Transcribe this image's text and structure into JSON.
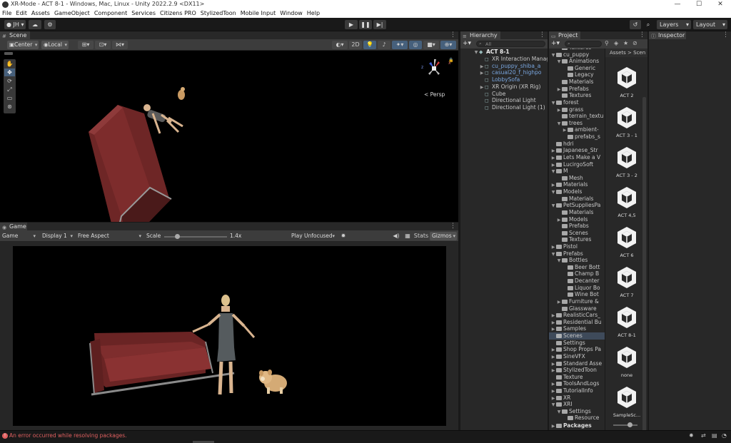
{
  "window": {
    "title": "XR-Mode - ACT 8-1 - Windows, Mac, Linux - Unity 2022.2.9 <DX11>",
    "minimize": "—",
    "maximize": "☐",
    "close": "✕"
  },
  "menu": [
    "File",
    "Edit",
    "Assets",
    "GameObject",
    "Component",
    "Services",
    "Citizens PRO",
    "StylizedToon",
    "Mobile Input",
    "Window",
    "Help"
  ],
  "toolbar": {
    "account": "JH",
    "layers": "Layers",
    "layout": "Layout",
    "search_icon": "search-icon"
  },
  "scene": {
    "tab": "Scene",
    "pivot": "Center",
    "space": "Local",
    "mode_2d": "2D",
    "gizmo_label": "< Persp",
    "axis_z": "z",
    "axis_x": "x"
  },
  "game": {
    "tab": "Game",
    "view": "Game",
    "display": "Display 1",
    "aspect": "Free Aspect",
    "scale_label": "Scale",
    "scale_value": "1.4x",
    "scale_fraction": 0.2,
    "play_mode": "Play Unfocused",
    "stats": "Stats",
    "gizmos": "Gizmos"
  },
  "hierarchy": {
    "tab": "Hierarchy",
    "search_placeholder": "All",
    "scene_name": "ACT 8-1",
    "items": [
      {
        "label": "XR Interaction Manag",
        "blue": false,
        "arrow": ""
      },
      {
        "label": "cu_puppy_shiba_a",
        "blue": true,
        "arrow": "▶"
      },
      {
        "label": "casual20_f_highpo",
        "blue": true,
        "arrow": "▶"
      },
      {
        "label": "LobbySofa",
        "blue": true,
        "arrow": ""
      },
      {
        "label": "XR Origin (XR Rig)",
        "blue": false,
        "arrow": "▶"
      },
      {
        "label": "Cube",
        "blue": false,
        "arrow": ""
      },
      {
        "label": "Directional Light",
        "blue": false,
        "arrow": ""
      },
      {
        "label": "Directional Light (1)",
        "blue": false,
        "arrow": ""
      }
    ]
  },
  "project": {
    "tab": "Project",
    "breadcrumb_assets": "Assets",
    "breadcrumb_sep": ">",
    "breadcrumb_current": "Scen",
    "tree": [
      {
        "label": "Textures",
        "depth": 2,
        "arrow": ""
      },
      {
        "label": "cu_puppy",
        "depth": 1,
        "arrow": "▼"
      },
      {
        "label": "Animations",
        "depth": 2,
        "arrow": "▼"
      },
      {
        "label": "Generic",
        "depth": 3,
        "arrow": ""
      },
      {
        "label": "Legacy",
        "depth": 3,
        "arrow": ""
      },
      {
        "label": "Materials",
        "depth": 2,
        "arrow": ""
      },
      {
        "label": "Prefabs",
        "depth": 2,
        "arrow": "▶"
      },
      {
        "label": "Textures",
        "depth": 2,
        "arrow": ""
      },
      {
        "label": "forest",
        "depth": 1,
        "arrow": "▼"
      },
      {
        "label": "grass",
        "depth": 2,
        "arrow": "▶"
      },
      {
        "label": "terrain_textu",
        "depth": 2,
        "arrow": ""
      },
      {
        "label": "trees",
        "depth": 2,
        "arrow": "▼"
      },
      {
        "label": "ambient-",
        "depth": 3,
        "arrow": "▶"
      },
      {
        "label": "prefabs_s",
        "depth": 3,
        "arrow": ""
      },
      {
        "label": "hdri",
        "depth": 1,
        "arrow": ""
      },
      {
        "label": "Japanese_Str",
        "depth": 1,
        "arrow": "▶"
      },
      {
        "label": "Lets Make a V",
        "depth": 1,
        "arrow": "▶"
      },
      {
        "label": "LucirgoSoft",
        "depth": 1,
        "arrow": "▶"
      },
      {
        "label": "M",
        "depth": 1,
        "arrow": "▼"
      },
      {
        "label": "Mesh",
        "depth": 2,
        "arrow": ""
      },
      {
        "label": "Materials",
        "depth": 1,
        "arrow": "▶"
      },
      {
        "label": "Models",
        "depth": 1,
        "arrow": "▼"
      },
      {
        "label": "Materials",
        "depth": 2,
        "arrow": ""
      },
      {
        "label": "PetSuppliesPa",
        "depth": 1,
        "arrow": "▼"
      },
      {
        "label": "Materials",
        "depth": 2,
        "arrow": ""
      },
      {
        "label": "Models",
        "depth": 2,
        "arrow": "▶"
      },
      {
        "label": "Prefabs",
        "depth": 2,
        "arrow": ""
      },
      {
        "label": "Scenes",
        "depth": 2,
        "arrow": ""
      },
      {
        "label": "Textures",
        "depth": 2,
        "arrow": ""
      },
      {
        "label": "Pistol",
        "depth": 1,
        "arrow": "▶"
      },
      {
        "label": "Prefabs",
        "depth": 1,
        "arrow": "▼"
      },
      {
        "label": "Bottles",
        "depth": 2,
        "arrow": "▼"
      },
      {
        "label": "Beer Bott",
        "depth": 3,
        "arrow": ""
      },
      {
        "label": "Champ B",
        "depth": 3,
        "arrow": ""
      },
      {
        "label": "Decanter",
        "depth": 3,
        "arrow": ""
      },
      {
        "label": "Liquor Bo",
        "depth": 3,
        "arrow": ""
      },
      {
        "label": "Wine Bot",
        "depth": 3,
        "arrow": ""
      },
      {
        "label": "Furniture &",
        "depth": 2,
        "arrow": "▶"
      },
      {
        "label": "Glassware",
        "depth": 2,
        "arrow": ""
      },
      {
        "label": "RealisticCars_",
        "depth": 1,
        "arrow": "▶"
      },
      {
        "label": "Residential Bu",
        "depth": 1,
        "arrow": "▶"
      },
      {
        "label": "Samples",
        "depth": 1,
        "arrow": "▶"
      },
      {
        "label": "Scenes",
        "depth": 1,
        "arrow": "",
        "selected": true
      },
      {
        "label": "Settings",
        "depth": 1,
        "arrow": ""
      },
      {
        "label": "Shop Props Pa",
        "depth": 1,
        "arrow": "▶"
      },
      {
        "label": "SineVFX",
        "depth": 1,
        "arrow": "▶"
      },
      {
        "label": "Standard Asse",
        "depth": 1,
        "arrow": "▶"
      },
      {
        "label": "StylizedToon",
        "depth": 1,
        "arrow": "▶"
      },
      {
        "label": "Texture",
        "depth": 1,
        "arrow": ""
      },
      {
        "label": "ToolsAndLogs",
        "depth": 1,
        "arrow": "▶"
      },
      {
        "label": "TutorialInfo",
        "depth": 1,
        "arrow": "▶"
      },
      {
        "label": "XR",
        "depth": 1,
        "arrow": "▶"
      },
      {
        "label": "XRI",
        "depth": 1,
        "arrow": "▼"
      },
      {
        "label": "Settings",
        "depth": 2,
        "arrow": "▼"
      },
      {
        "label": "Resource",
        "depth": 3,
        "arrow": ""
      }
    ],
    "packages": "Packages",
    "scenes": [
      "ACT 2",
      "ACT 3 - 1",
      "ACT 3 - 2",
      "ACT 4,5",
      "ACT 6",
      "ACT 7",
      "ACT 8-1",
      "none",
      "SampleSc..."
    ],
    "search_placeholder": ""
  },
  "inspector": {
    "tab": "Inspector"
  },
  "status": {
    "error": "An error occurred while resolving packages."
  },
  "colors": {
    "accent_blue": "#7aa7e0",
    "error_red": "#e06060",
    "sofa_red": "#7a2a2a"
  }
}
